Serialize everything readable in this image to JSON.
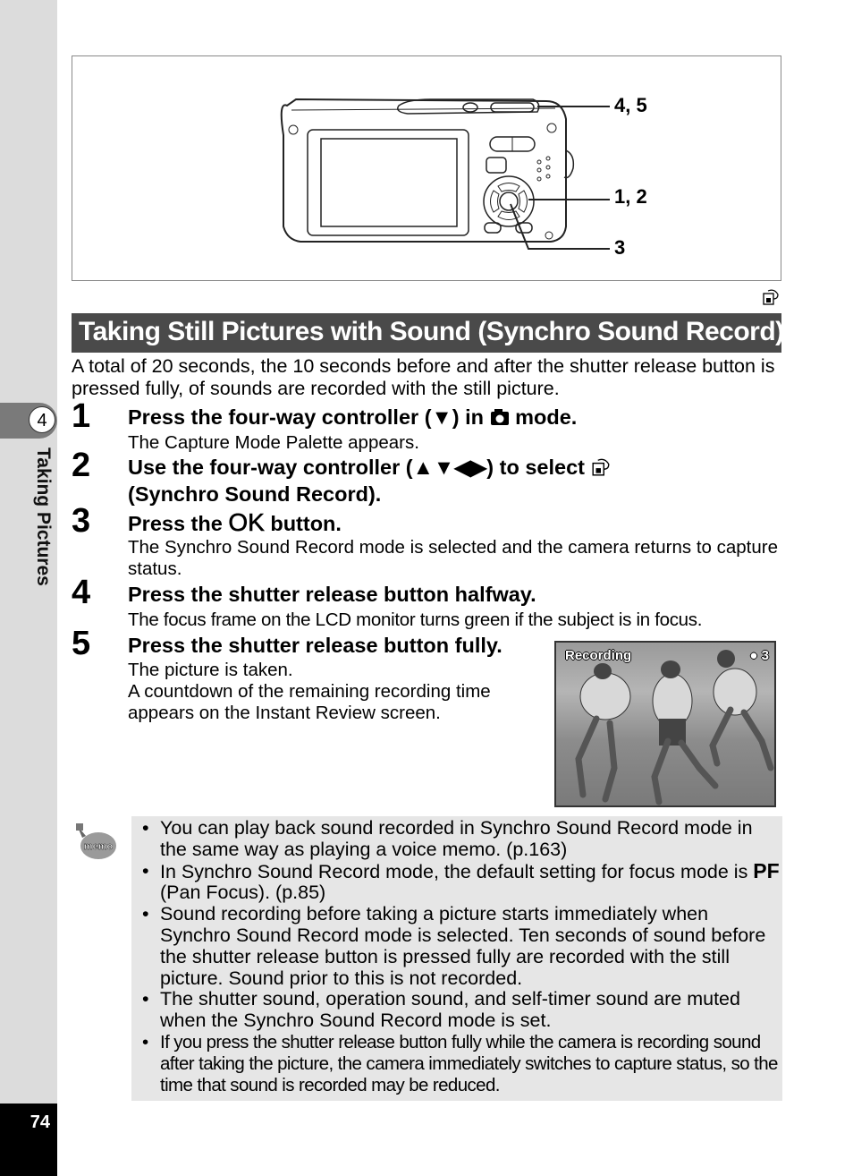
{
  "sidebar": {
    "chapter_number": "4",
    "chapter_label": "Taking Pictures",
    "page_number": "74"
  },
  "figure": {
    "callouts": [
      "4, 5",
      "1, 2",
      "3"
    ]
  },
  "section": {
    "mode_icon": "synchro-sound-record-icon",
    "title": "Taking Still Pictures with Sound (Synchro Sound Record)",
    "intro": "A total of 20 seconds, the 10 seconds before and after the shutter release button is pressed fully, of sounds are recorded with the still picture."
  },
  "steps": [
    {
      "number": "1",
      "heading_pre": "Press the four-way controller (▼) in ",
      "heading_icon": "camera-icon",
      "heading_post": " mode.",
      "body": "The Capture Mode Palette appears."
    },
    {
      "number": "2",
      "heading_line1": "Use the four-way controller (▲▼◀▶) to select ",
      "heading_icon": "synchro-sound-record-icon",
      "heading_line2": "(Synchro Sound Record).",
      "body": ""
    },
    {
      "number": "3",
      "heading_pre": "Press the ",
      "heading_ok": "OK",
      "heading_post": " button.",
      "body": "The Synchro Sound Record mode is selected and the camera returns to capture status."
    },
    {
      "number": "4",
      "heading": "Press the shutter release button halfway.",
      "body": "The focus frame on the LCD monitor turns green if the subject is in focus."
    },
    {
      "number": "5",
      "heading": "Press the shutter release button fully.",
      "body_lines": [
        "The picture is taken.",
        "A countdown of the remaining recording time appears on the Instant Review screen."
      ]
    }
  ],
  "review_screen": {
    "status_label": "Recording",
    "countdown": "3"
  },
  "memo": {
    "icon_label": "memo",
    "items": [
      "You can play back sound recorded in Synchro Sound Record mode in the same way as playing a voice memo. (p.163)",
      {
        "pre": "In Synchro Sound Record mode, the default setting for focus mode is ",
        "bold": "PF",
        "post": " (Pan Focus). (p.85)"
      },
      "Sound recording before taking a picture starts immediately when Synchro Sound Record mode is selected. Ten seconds of sound before the shutter release button is pressed fully are recorded with the still picture. Sound prior to this is not recorded.",
      "The shutter sound, operation sound, and self-timer sound are muted when the Synchro Sound Record mode is set.",
      "If you press the shutter release button fully while the camera is recording sound after taking the picture, the camera immediately switches to capture status, so the time that sound is recorded may be reduced."
    ]
  }
}
